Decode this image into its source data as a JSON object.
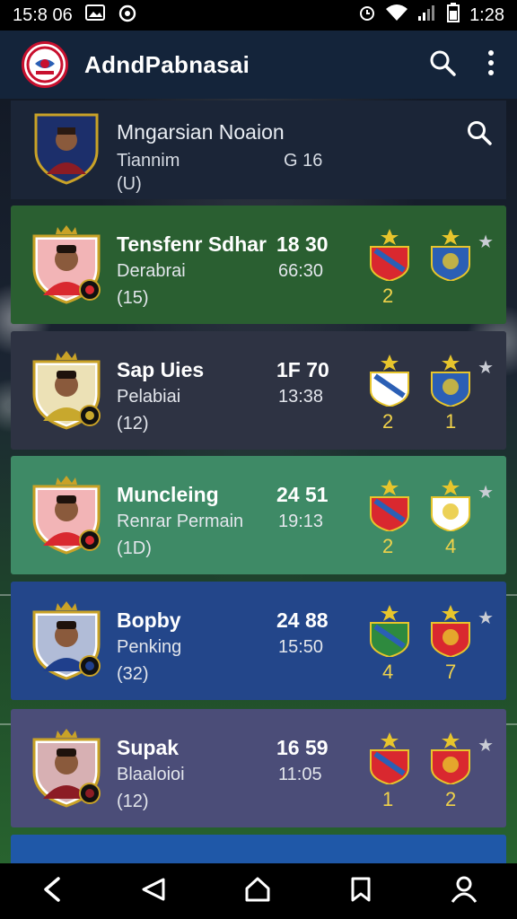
{
  "status_bar": {
    "time": "15:8 06",
    "battery_time": "1:28"
  },
  "app": {
    "title": "AdndPabnasai"
  },
  "header": {
    "title": "Mngarsian Noaion",
    "subtitle": "Tiannim",
    "count": "G 16",
    "rank": "(U)"
  },
  "matches": [
    {
      "name": "Tensfenr Sdhar",
      "sub": "Derabrai",
      "rank": "(15)",
      "score": "18 30",
      "time": "66:30",
      "home": "2",
      "away": "",
      "color": "#2a5f31",
      "photo_bg": "#d9282f"
    },
    {
      "name": "Sap Uies",
      "sub": "Pelabiai",
      "rank": "(12)",
      "score": "1F 70",
      "time": "13:38",
      "home": "2",
      "away": "1",
      "color": "#2e3343",
      "photo_bg": "#c8a82d"
    },
    {
      "name": "Muncleing",
      "sub": "Renrar Permain",
      "rank": "(1D)",
      "score": "24 51",
      "time": "19:13",
      "home": "2",
      "away": "4",
      "color": "#3e8a66",
      "photo_bg": "#d9282f"
    },
    {
      "name": "Bopby",
      "sub": "Penking",
      "rank": "(32)",
      "score": "24 88",
      "time": "15:50",
      "home": "4",
      "away": "7",
      "color": "#23468a",
      "photo_bg": "#1f3f8c"
    },
    {
      "name": "Supak",
      "sub": "Blaaloioi",
      "rank": "(12)",
      "score": "16 59",
      "time": "11:05",
      "home": "1",
      "away": "2",
      "color": "#4b4d78",
      "photo_bg": "#8c1c24"
    }
  ]
}
